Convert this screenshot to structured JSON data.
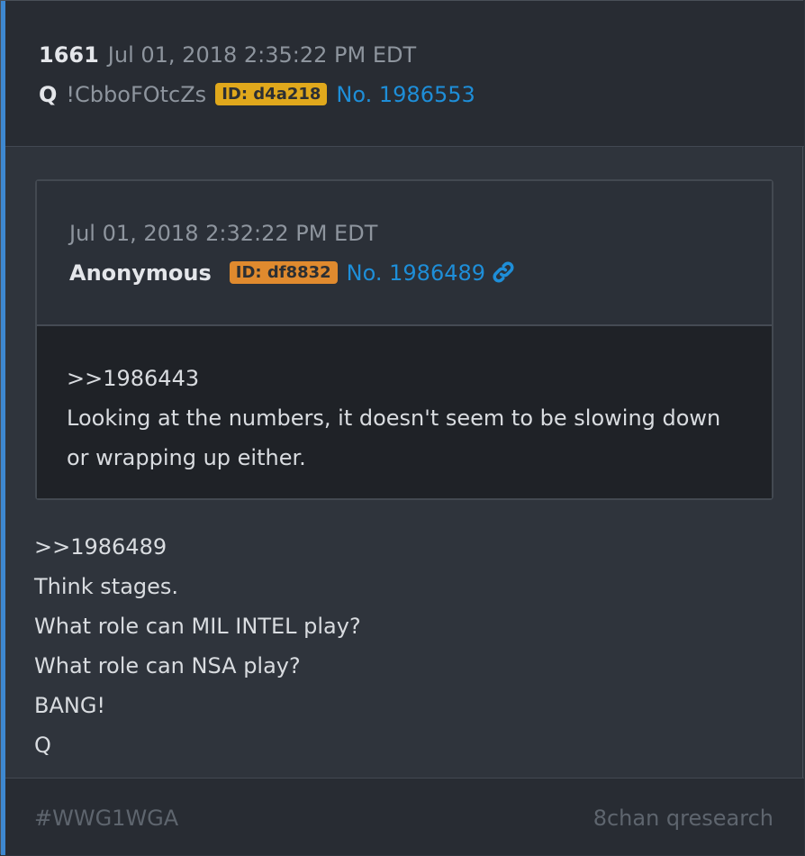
{
  "post": {
    "number": "1661",
    "timestamp": "Jul 01, 2018 2:35:22 PM EDT",
    "author": "Q",
    "tripcode": "!CbboFOtcZs",
    "id_label": "ID: d4a218",
    "post_no": "No. 1986553",
    "body_lines": [
      ">>1986489",
      "Think stages.",
      "What role can MIL INTEL play?",
      "What role can NSA play?",
      "BANG!",
      "Q"
    ]
  },
  "quoted": {
    "timestamp": "Jul 01, 2018 2:32:22 PM EDT",
    "author": "Anonymous",
    "id_label": "ID: df8832",
    "post_no": "No. 1986489",
    "link_icon": "link-icon",
    "body_lines": [
      ">>1986443",
      "Looking at the numbers, it doesn't seem to be slowing down",
      "or wrapping up either."
    ]
  },
  "footer": {
    "hashtag": "#WWG1WGA",
    "source": "8chan qresearch"
  },
  "colors": {
    "accent": "#3e88d0",
    "q_id_badge": "#e0a81c",
    "anon_id_badge": "#e08a2e",
    "link": "#1e8ed8"
  }
}
